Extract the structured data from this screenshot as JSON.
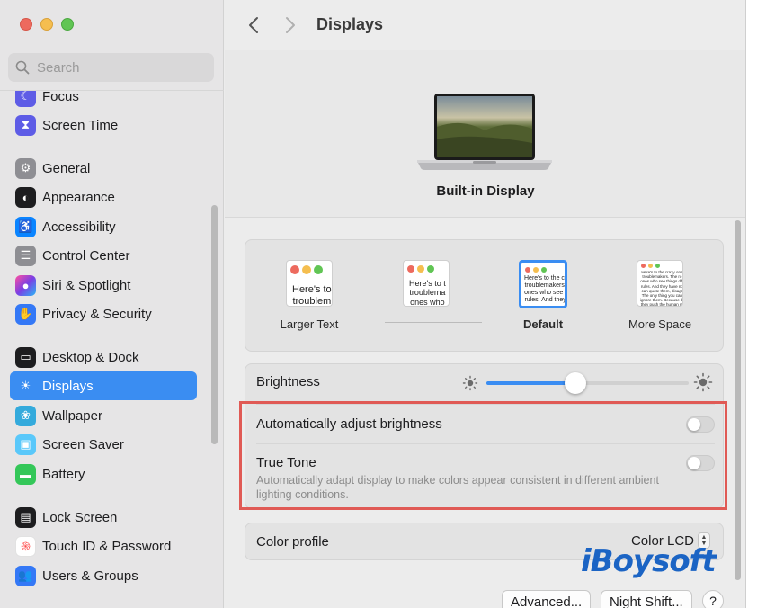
{
  "window": {
    "title": "Displays"
  },
  "search": {
    "placeholder": "Search"
  },
  "sidebar": {
    "items": [
      {
        "label": "Focus",
        "icon": "moon-icon",
        "color": "#5e5ce6"
      },
      {
        "label": "Screen Time",
        "icon": "hourglass-icon",
        "color": "#5e5ce6"
      },
      {
        "label": "General",
        "icon": "gear-icon",
        "color": "#8e8e93"
      },
      {
        "label": "Appearance",
        "icon": "appearance-icon",
        "color": "#1d1d1f"
      },
      {
        "label": "Accessibility",
        "icon": "accessibility-icon",
        "color": "#0a84ff"
      },
      {
        "label": "Control Center",
        "icon": "control-center-icon",
        "color": "#8e8e93"
      },
      {
        "label": "Siri & Spotlight",
        "icon": "siri-icon",
        "color": "#7b3fe4"
      },
      {
        "label": "Privacy & Security",
        "icon": "hand-icon",
        "color": "#3478f6"
      },
      {
        "label": "Desktop & Dock",
        "icon": "dock-icon",
        "color": "#1d1d1f"
      },
      {
        "label": "Displays",
        "icon": "sun-icon",
        "color": "#3a8df2"
      },
      {
        "label": "Wallpaper",
        "icon": "flower-icon",
        "color": "#34aadc"
      },
      {
        "label": "Screen Saver",
        "icon": "screen-saver-icon",
        "color": "#5ac8fa"
      },
      {
        "label": "Battery",
        "icon": "battery-icon",
        "color": "#34c759"
      },
      {
        "label": "Lock Screen",
        "icon": "lock-screen-icon",
        "color": "#1d1d1f"
      },
      {
        "label": "Touch ID & Password",
        "icon": "fingerprint-icon",
        "color": "#ff6b6b"
      },
      {
        "label": "Users & Groups",
        "icon": "users-icon",
        "color": "#3478f6"
      }
    ]
  },
  "main": {
    "display_name": "Built-in Display",
    "resolution_options": [
      {
        "label": "Larger Text",
        "sample": "Here's to\ntroublem"
      },
      {
        "label": "",
        "sample": "Here's to t\ntroublema\nones who"
      },
      {
        "label": "Default",
        "sample": "Here's to the cr\ntroublemakers.\nones who see t\nrules. And they"
      },
      {
        "label": "More Space",
        "sample": "Here's to the crazy one\ntroublemakers. The ro\nones who see things diff\nrules. And they have no\ncan quote them, disagr\nThe only thing you can\nignore them. Because th\nthey push the human ra\nBecause the ones who"
      }
    ],
    "brightness": {
      "label": "Brightness",
      "value": 0.44
    },
    "auto_brightness": {
      "label": "Automatically adjust brightness",
      "enabled": false
    },
    "true_tone": {
      "label": "True Tone",
      "description": "Automatically adapt display to make colors appear consistent in different ambient lighting conditions.",
      "enabled": false
    },
    "color_profile": {
      "label": "Color profile",
      "value": "Color LCD"
    },
    "buttons": {
      "advanced": "Advanced...",
      "night_shift": "Night Shift...",
      "help": "?"
    }
  },
  "watermark": "iBoysoft"
}
